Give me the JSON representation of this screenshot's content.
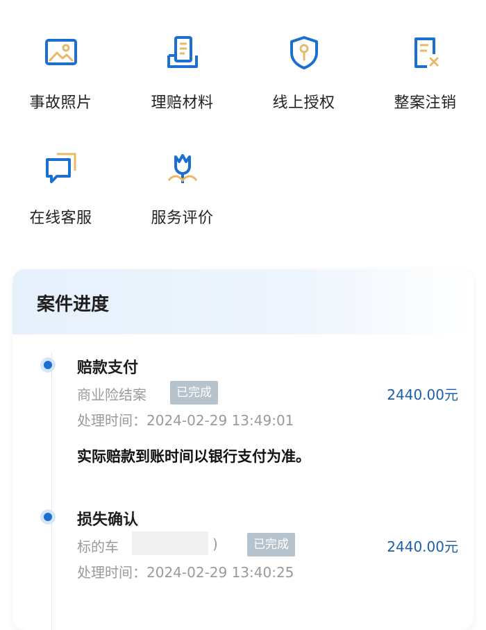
{
  "actions": [
    {
      "label": "事故照片",
      "icon": "image-icon"
    },
    {
      "label": "理赔材料",
      "icon": "documents-icon"
    },
    {
      "label": "线上授权",
      "icon": "shield-key-icon"
    },
    {
      "label": "整案注销",
      "icon": "cancel-document-icon"
    },
    {
      "label": "在线客服",
      "icon": "chat-icon"
    },
    {
      "label": "服务评价",
      "icon": "flower-rating-icon"
    }
  ],
  "progress": {
    "title": "案件进度",
    "steps": [
      {
        "title": "赔款支付",
        "subtitle": "商业险结案",
        "status": "已完成",
        "amount": "2440.00元",
        "time": "处理时间：2024-02-29 13:49:01",
        "note": "实际赔款到账时间以银行支付为准。"
      },
      {
        "title": "损失确认",
        "subtitle": "标的车",
        "subtitle_suffix": ")",
        "status": "已完成",
        "amount": "2440.00元",
        "time": "处理时间：2024-02-29 13:40:25"
      }
    ]
  },
  "colors": {
    "icon_blue": "#1a6fd1",
    "icon_gold": "#e8b86a",
    "amount_blue": "#1c5fa8"
  }
}
